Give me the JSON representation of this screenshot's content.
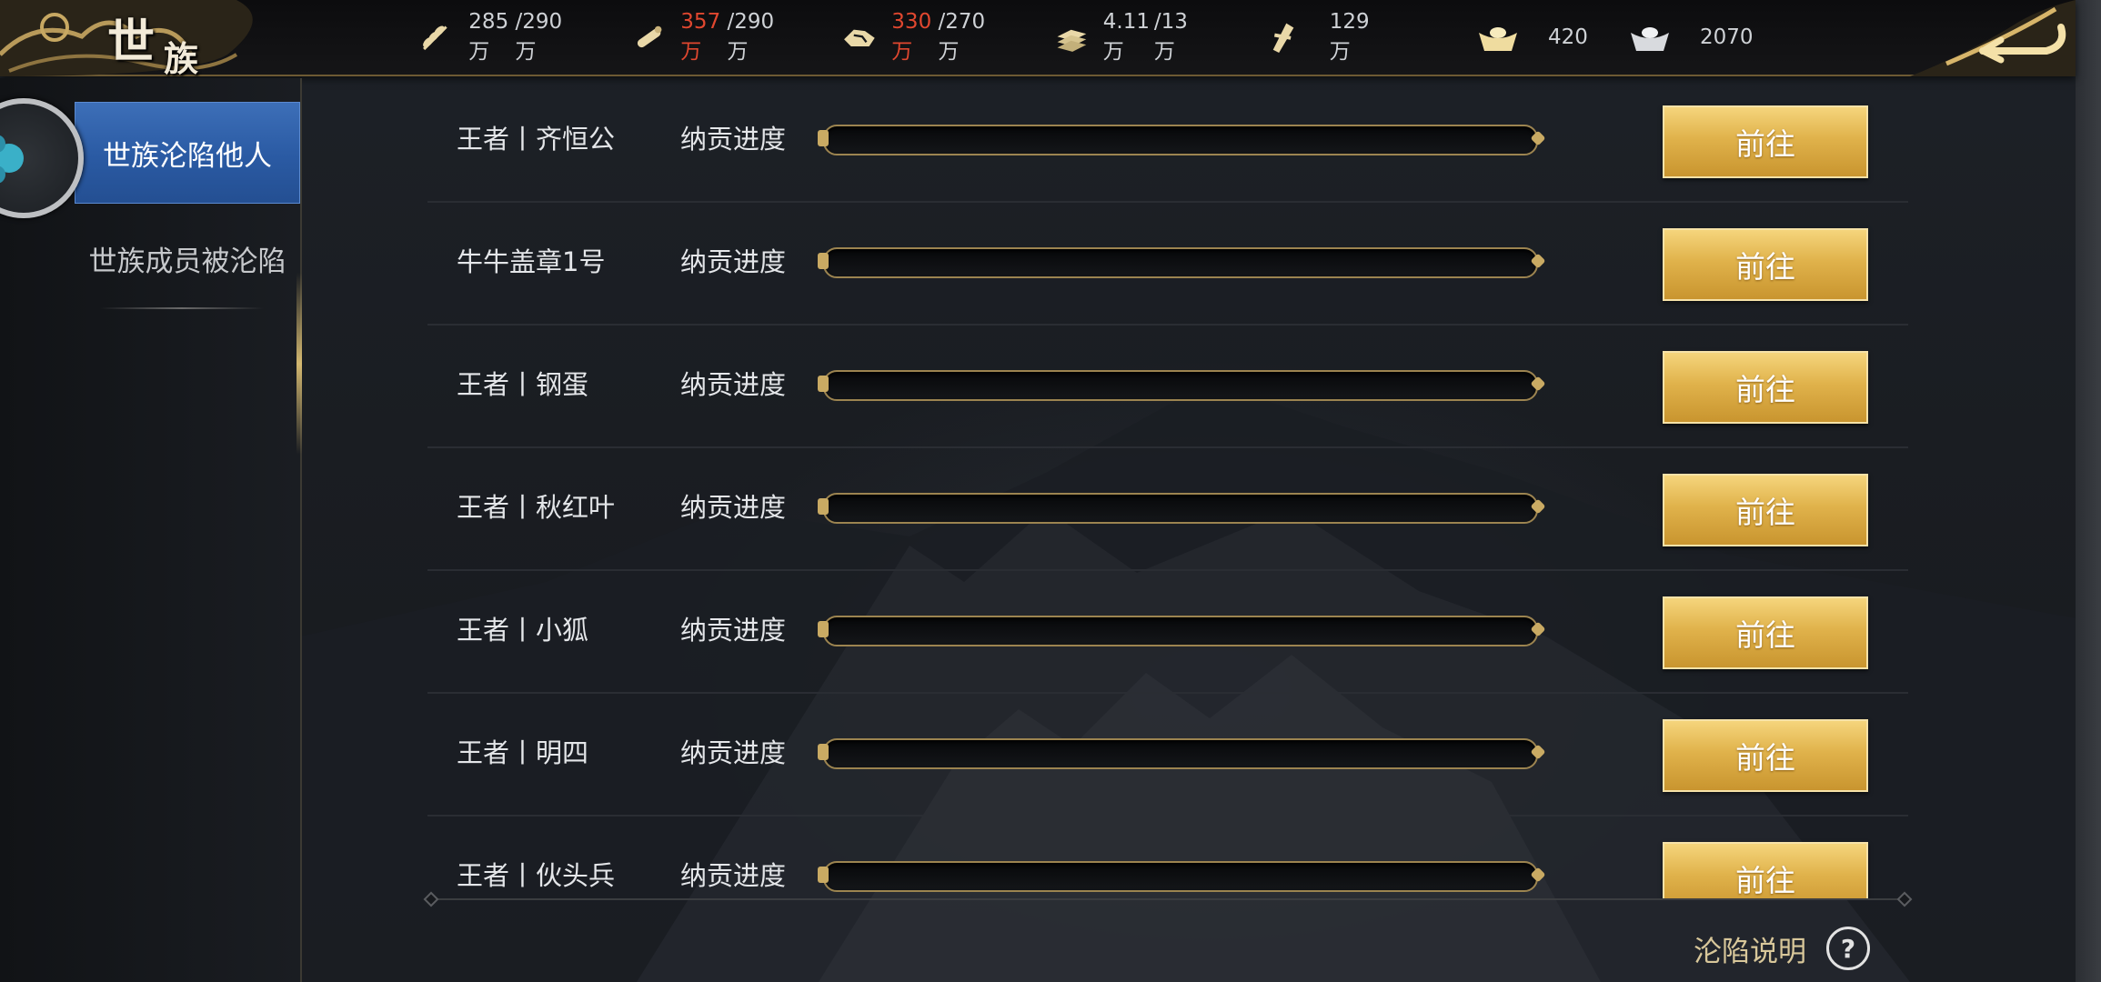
{
  "header": {
    "title_char1": "世",
    "title_char2": "族",
    "resources": [
      {
        "icon": "grain-icon",
        "current": "285万",
        "max": "/290万",
        "over_limit": false
      },
      {
        "icon": "wood-icon",
        "current": "357万",
        "max": "/290万",
        "over_limit": true
      },
      {
        "icon": "stone-icon",
        "current": "330万",
        "max": "/270万",
        "over_limit": true
      },
      {
        "icon": "iron-icon",
        "current": "4.11万",
        "max": "/13万",
        "over_limit": false
      },
      {
        "icon": "decree-icon",
        "current": "129万",
        "max": "",
        "over_limit": false
      },
      {
        "icon": "gold-ingot-icon",
        "current": "420",
        "max": "",
        "over_limit": false
      },
      {
        "icon": "silver-ingot-icon",
        "current": "2070",
        "max": "",
        "over_limit": false
      }
    ],
    "back_icon": "back-arrow-icon"
  },
  "sidebar": {
    "tabs": [
      {
        "label": "世族沦陷他人",
        "active": true
      },
      {
        "label": "世族成员被沦陷",
        "active": false
      }
    ]
  },
  "list": {
    "rows": [
      {
        "name": "王者丨齐恒公",
        "progress_label": "纳贡进度",
        "progress": 0,
        "button": "前往"
      },
      {
        "name": "牛牛盖章1号",
        "progress_label": "纳贡进度",
        "progress": 0,
        "button": "前往"
      },
      {
        "name": "王者丨钢蛋",
        "progress_label": "纳贡进度",
        "progress": 0,
        "button": "前往"
      },
      {
        "name": "王者丨秋红叶",
        "progress_label": "纳贡进度",
        "progress": 0,
        "button": "前往"
      },
      {
        "name": "王者丨小狐",
        "progress_label": "纳贡进度",
        "progress": 0,
        "button": "前往"
      },
      {
        "name": "王者丨明四",
        "progress_label": "纳贡进度",
        "progress": 0,
        "button": "前往"
      },
      {
        "name": "王者丨伙头兵",
        "progress_label": "纳贡进度",
        "progress": 0,
        "button": "前往"
      }
    ]
  },
  "footer": {
    "help_label": "沦陷说明",
    "help_icon_glyph": "?"
  },
  "colors": {
    "accent_gold": "#e0b24b",
    "tab_active_blue": "#2a5aa3",
    "over_limit_red": "#e0472f"
  }
}
